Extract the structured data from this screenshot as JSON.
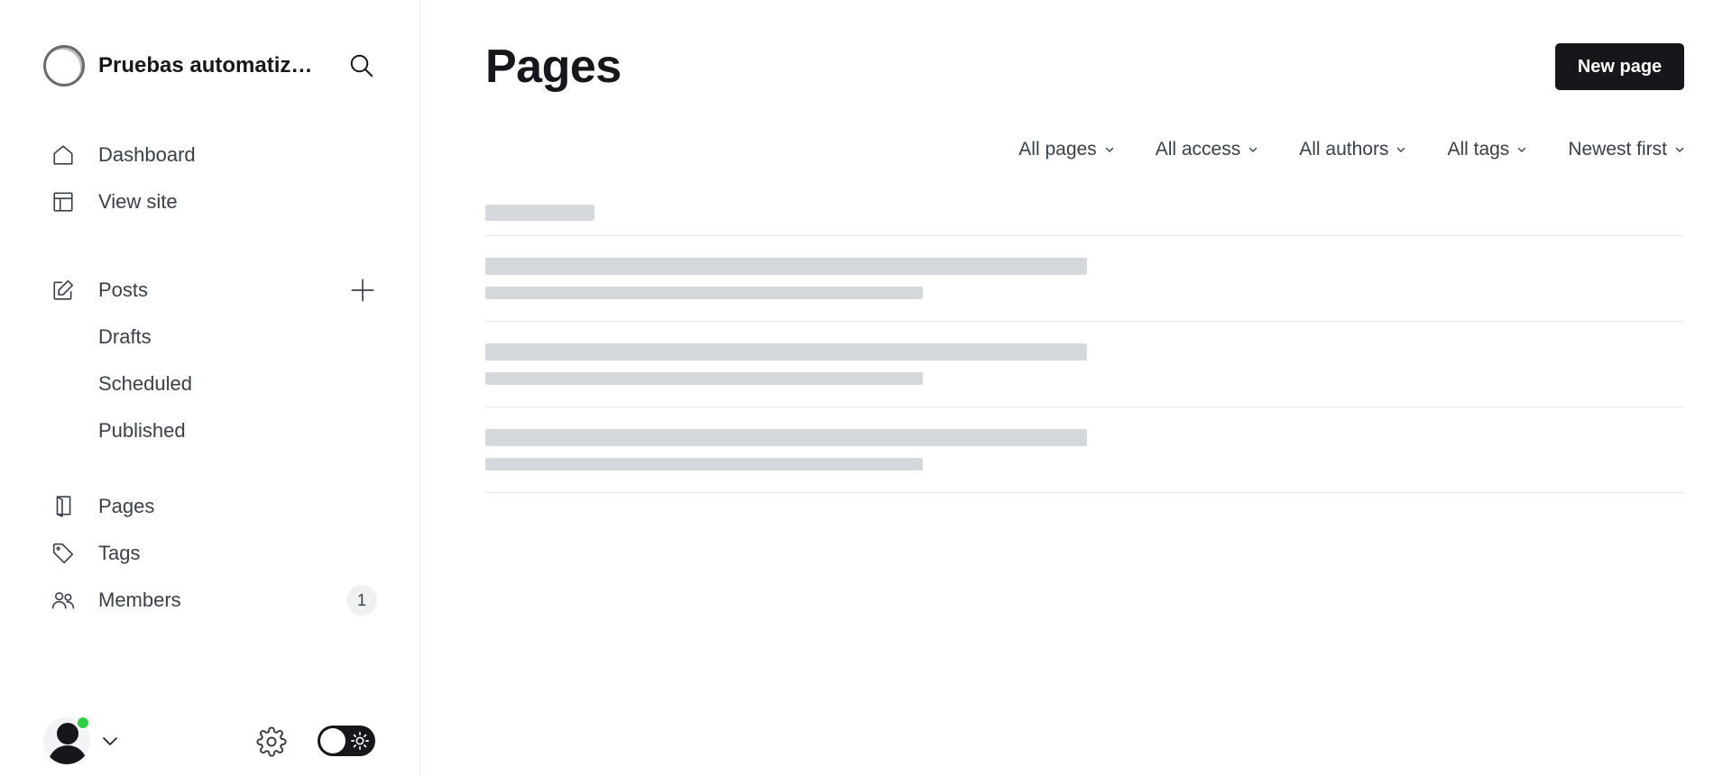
{
  "site": {
    "title": "Pruebas automatizadas"
  },
  "nav": {
    "dashboard": "Dashboard",
    "view_site": "View site",
    "posts": "Posts",
    "drafts": "Drafts",
    "scheduled": "Scheduled",
    "published": "Published",
    "pages": "Pages",
    "tags": "Tags",
    "members": "Members",
    "members_count": "1"
  },
  "main": {
    "title": "Pages",
    "new_button": "New page",
    "filters": [
      "All pages",
      "All access",
      "All authors",
      "All tags",
      "Newest first"
    ]
  },
  "colors": {
    "accent": "#15171a",
    "status_online": "#30cf43",
    "skeleton": "#d3d8dc"
  },
  "icons": [
    "search-icon",
    "home-icon",
    "layout-icon",
    "edit-icon",
    "plus-icon",
    "page-icon",
    "tag-icon",
    "members-icon",
    "chevron-down-icon",
    "gear-icon",
    "sun-icon"
  ]
}
